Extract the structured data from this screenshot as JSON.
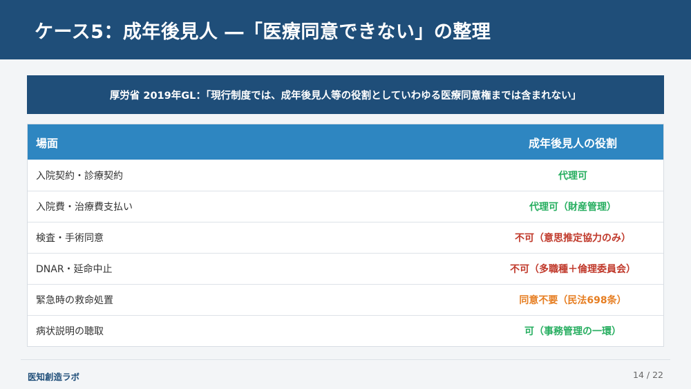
{
  "slide": {
    "title": "ケース5：成年後見人 ―「医療同意できない」の整理",
    "banner": "厚労省 2019年GL：「現行制度では、成年後見人等の役割としていわゆる医療同意権までは含まれない」"
  },
  "table": {
    "headers": {
      "scene": "場面",
      "role": "成年後見人の役割"
    },
    "rows": [
      {
        "scene": "入院契約・診療契約",
        "role": "代理可",
        "color": "#27ae60"
      },
      {
        "scene": "入院費・治療費支払い",
        "role": "代理可（財産管理）",
        "color": "#27ae60"
      },
      {
        "scene": "検査・手術同意",
        "role": "不可（意思推定協力のみ）",
        "color": "#c0392b"
      },
      {
        "scene": "DNAR・延命中止",
        "role": "不可（多職種＋倫理委員会）",
        "color": "#c0392b"
      },
      {
        "scene": "緊急時の救命処置",
        "role": "同意不要（民法698条）",
        "color": "#e67e22"
      },
      {
        "scene": "病状説明の聴取",
        "role": "可（事務管理の一環）",
        "color": "#27ae60"
      }
    ]
  },
  "footer": {
    "brand": "医知創造ラボ",
    "page": "14 / 22"
  },
  "colors": {
    "primary": "#1f4e79",
    "header_blue": "#2e86c1",
    "green": "#27ae60",
    "red": "#c0392b",
    "orange": "#e67e22"
  }
}
